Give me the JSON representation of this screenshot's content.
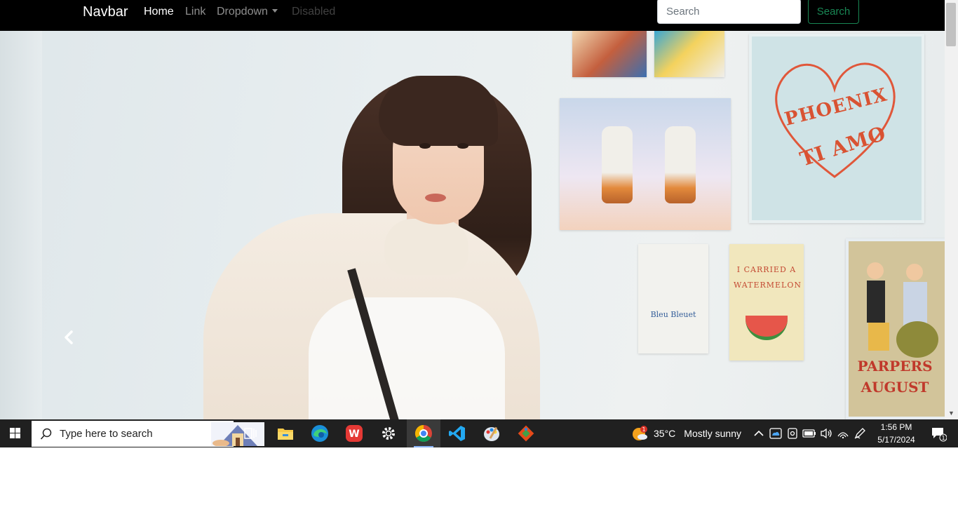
{
  "navbar": {
    "brand": "Navbar",
    "links": {
      "home": "Home",
      "link": "Link",
      "dropdown": "Dropdown",
      "disabled": "Disabled"
    },
    "search": {
      "placeholder": "Search",
      "button": "Search"
    },
    "accent_color": "#198754"
  },
  "hero": {
    "poster_texts": {
      "heart_top": "PHOENIX",
      "heart_bottom": "TI AMO",
      "blank_poster": "Bleu Bleuet",
      "melon_poster": "I CARRIED A WATERMELON",
      "fashion_poster_title": "PARPERS",
      "fashion_poster_month": "AUGUST"
    },
    "prev_icon": "chevron-left-icon"
  },
  "taskbar": {
    "search_placeholder": "Type here to search",
    "apps": [
      "task-view",
      "file-explorer",
      "edge",
      "wps-office",
      "settings",
      "chrome",
      "vscode",
      "paint",
      "git"
    ],
    "weather": {
      "temp": "35°C",
      "desc": "Mostly sunny",
      "badge": "1"
    },
    "clock": {
      "time": "1:56 PM",
      "date": "5/17/2024"
    },
    "notification_count": "1"
  }
}
